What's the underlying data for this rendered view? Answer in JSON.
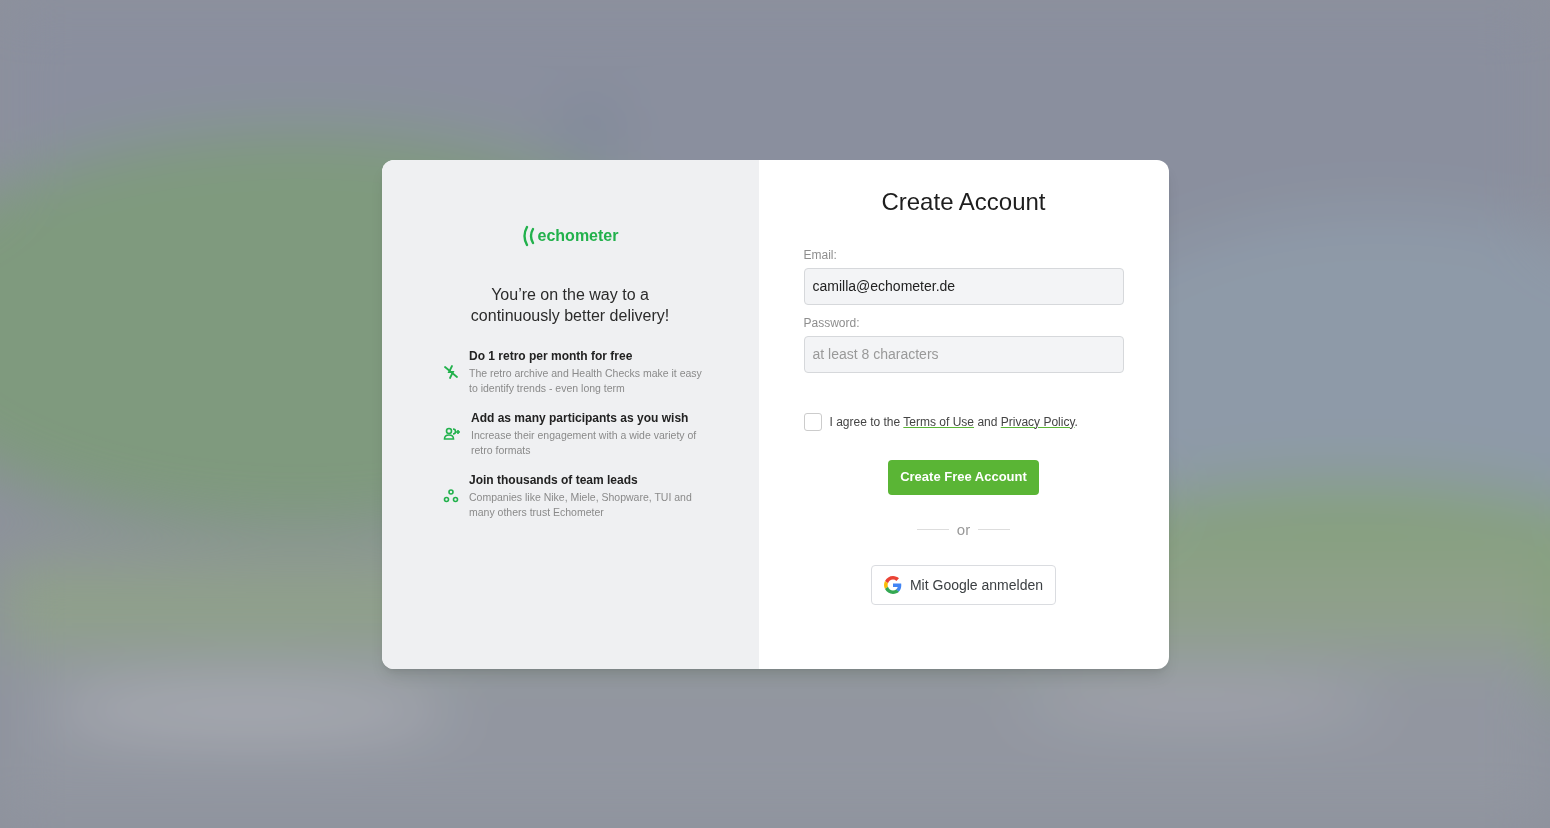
{
  "promo": {
    "logo_text": "echometer",
    "headline": "You’re on the way to a continuously better delivery!",
    "features": [
      {
        "kind": "retro",
        "title": "Do 1 retro per month for free",
        "text": "The retro archive and Health Checks make it easy to identify trends - even long term"
      },
      {
        "kind": "participants",
        "title": "Add as many participants as you wish",
        "text": "Increase their engagement with a wide variety of retro formats"
      },
      {
        "kind": "teams",
        "title": "Join thousands of team leads",
        "text": "Companies like Nike, Miele, Shopware, TUI and many others trust Echometer"
      }
    ]
  },
  "form": {
    "title": "Create Account",
    "email": {
      "label": "Email:",
      "value": "camilla@echometer.de"
    },
    "password": {
      "label": "Password:",
      "placeholder": "at least 8 characters"
    },
    "agreement": {
      "checked": false,
      "prefix": "I agree to the",
      "terms_link": "Terms of Use",
      "middle": "and",
      "privacy_link": "Privacy Policy",
      "suffix": "."
    },
    "submit": "Create Free Account",
    "divider": "or",
    "google_button": "Mit Google anmelden"
  }
}
